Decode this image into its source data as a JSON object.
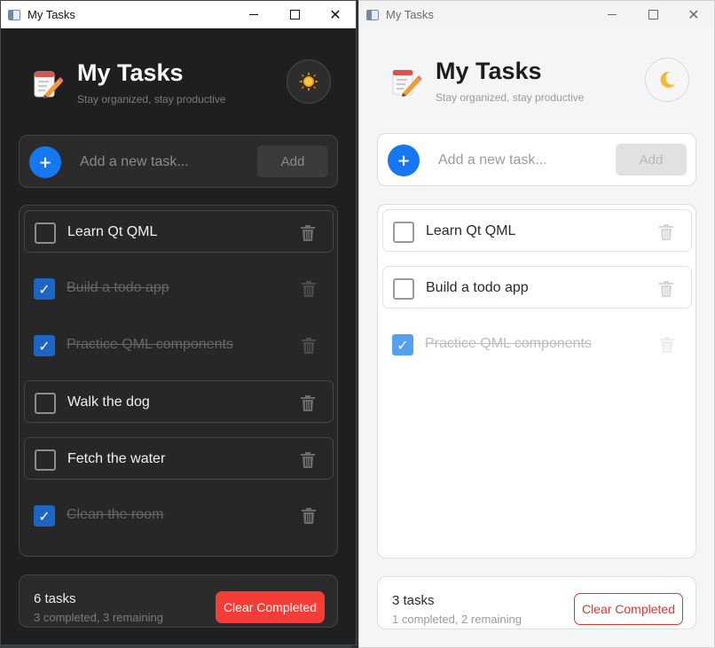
{
  "colors": {
    "accent": "#1677f2",
    "danger": "#f43d37",
    "dark_background": "#1f1f1f",
    "light_background": "#f4f5f7",
    "dark_checked": "#1d64c4",
    "light_checked": "#55a1ef"
  },
  "dark_window": {
    "window_title": "My Tasks",
    "app_title": "My Tasks",
    "subtitle": "Stay organized, stay productive",
    "theme_toggle_icon": "sun-icon",
    "add_icon": "plus-icon",
    "input_placeholder": "Add a new task...",
    "add_label": "Add",
    "tasks": [
      {
        "label": "Learn Qt QML",
        "completed": false
      },
      {
        "label": "Build a todo app",
        "completed": true
      },
      {
        "label": "Practice QML components",
        "completed": true
      },
      {
        "label": "Walk the dog",
        "completed": false
      },
      {
        "label": "Fetch the water",
        "completed": false
      },
      {
        "label": "Clean the room",
        "completed": true
      }
    ],
    "check_mark": "✓",
    "task_count": "6 tasks",
    "summary": "3 completed, 3 remaining",
    "clear_label": "Clear Completed"
  },
  "light_window": {
    "window_title": "My Tasks",
    "app_title": "My Tasks",
    "subtitle": "Stay organized, stay productive",
    "theme_toggle_icon": "moon-icon",
    "add_icon": "plus-icon",
    "input_placeholder": "Add a new task...",
    "add_label": "Add",
    "tasks": [
      {
        "label": "Learn Qt QML",
        "completed": false
      },
      {
        "label": "Build a todo app",
        "completed": false
      },
      {
        "label": "Practice QML components",
        "completed": true
      }
    ],
    "check_mark": "✓",
    "task_count": "3 tasks",
    "summary": "1 completed, 2 remaining",
    "clear_label": "Clear Completed"
  }
}
